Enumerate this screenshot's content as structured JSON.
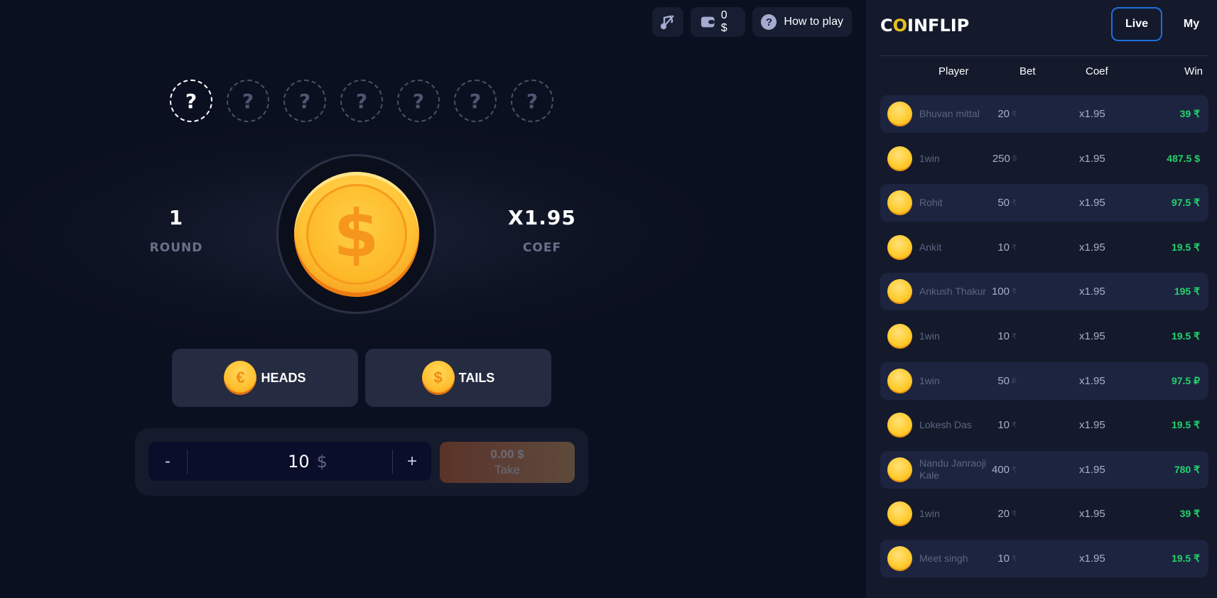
{
  "toolbar": {
    "sound_icon": "music-muted-icon",
    "balance_icon": "wallet-icon",
    "balance": "0 $",
    "help_icon": "question-icon",
    "help_glyph": "?",
    "how_to_play": "How to play"
  },
  "history": {
    "slots": [
      "?",
      "?",
      "?",
      "?",
      "?",
      "?",
      "?"
    ],
    "active_index": 0
  },
  "game": {
    "round_value": "1",
    "round_label": "ROUND",
    "coef_value": "X1.95",
    "coef_label": "COEF",
    "coin_symbol": "$"
  },
  "choices": {
    "heads_label": "HEADS",
    "heads_symbol": "€",
    "tails_label": "TAILS",
    "tails_symbol": "$"
  },
  "bet": {
    "minus": "-",
    "plus": "+",
    "amount": "10",
    "currency": "$",
    "take_amount": "0.00 $",
    "take_label": "Take"
  },
  "panel": {
    "logo_pre": "C",
    "logo_o": "O",
    "logo_post": "INFLIP",
    "tabs": {
      "live": "Live",
      "my": "My"
    },
    "columns": {
      "player": "Player",
      "bet": "Bet",
      "coef": "Coef",
      "win": "Win"
    },
    "rows": [
      {
        "player": "Bhuvan mittal",
        "bet": "20",
        "bet_cur": "₹",
        "coef": "x1.95",
        "win": "39 ₹"
      },
      {
        "player": "1win",
        "bet": "250",
        "bet_cur": "$",
        "coef": "x1.95",
        "win": "487.5 $"
      },
      {
        "player": "Rohit",
        "bet": "50",
        "bet_cur": "₹",
        "coef": "x1.95",
        "win": "97.5 ₹"
      },
      {
        "player": "Ankit",
        "bet": "10",
        "bet_cur": "₹",
        "coef": "x1.95",
        "win": "19.5 ₹"
      },
      {
        "player": "Ankush Thakur",
        "bet": "100",
        "bet_cur": "₹",
        "coef": "x1.95",
        "win": "195 ₹"
      },
      {
        "player": "1win",
        "bet": "10",
        "bet_cur": "₹",
        "coef": "x1.95",
        "win": "19.5 ₹"
      },
      {
        "player": "1win",
        "bet": "50",
        "bet_cur": "₽",
        "coef": "x1.95",
        "win": "97.5 ₽"
      },
      {
        "player": "Lokesh Das",
        "bet": "10",
        "bet_cur": "₹",
        "coef": "x1.95",
        "win": "19.5 ₹"
      },
      {
        "player": "Nandu Janraoji Kale",
        "bet": "400",
        "bet_cur": "₹",
        "coef": "x1.95",
        "win": "780 ₹"
      },
      {
        "player": "1win",
        "bet": "20",
        "bet_cur": "₹",
        "coef": "x1.95",
        "win": "39 ₹"
      },
      {
        "player": "Meet singh",
        "bet": "10",
        "bet_cur": "₹",
        "coef": "x1.95",
        "win": "19.5 ₹"
      }
    ]
  },
  "colors": {
    "win_green": "#22d36b",
    "live_tab_border": "#1e6fe0",
    "coin_gold": "#ffc233",
    "logo_accent": "#e6c21a"
  }
}
